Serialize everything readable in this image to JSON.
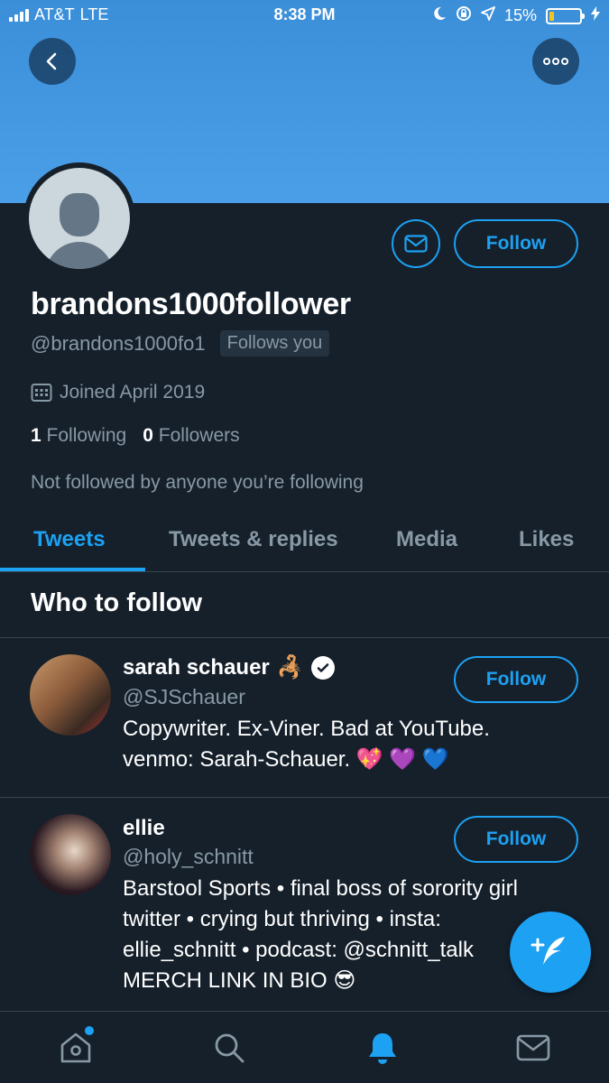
{
  "status_bar": {
    "carrier": "AT&T",
    "network": "LTE",
    "time": "8:38 PM",
    "battery": "15%"
  },
  "profile": {
    "display_name": "brandons1000follower",
    "handle": "@brandons1000fo1",
    "follows_you": "Follows you",
    "joined": "Joined April 2019",
    "following_count": "1",
    "following_label": "Following",
    "followers_count": "0",
    "followers_label": "Followers",
    "mutuals": "Not followed by anyone you’re following",
    "follow_label": "Follow"
  },
  "tabs": [
    {
      "label": "Tweets",
      "active": true
    },
    {
      "label": "Tweets & replies",
      "active": false
    },
    {
      "label": "Media",
      "active": false
    },
    {
      "label": "Likes",
      "active": false
    }
  ],
  "who_to_follow": {
    "title": "Who to follow",
    "users": [
      {
        "name": "sarah schauer",
        "name_emoji": "🦂",
        "handle": "@SJSchauer",
        "bio_line1": "Copywriter. Ex-Viner. Bad at YouTube.",
        "bio_line2": "venmo: Sarah-Schauer. 💖 💜 💙",
        "follow_label": "Follow",
        "verified": true
      },
      {
        "name": "ellie",
        "handle": "@holy_schnitt",
        "bio_line1": "Barstool Sports • final boss of sorority girl",
        "bio_line2": "twitter • crying but thriving • insta:",
        "bio_line3": "ellie_schnitt • podcast: @schnitt_talk",
        "bio_line4": "MERCH LINK IN BIO 😎",
        "follow_label": "Follow",
        "verified": false
      }
    ]
  },
  "colors": {
    "background": "#15202b",
    "accent": "#1da1f2",
    "secondary_text": "#8899a6",
    "banner": "#4a9fe8"
  },
  "icons": {
    "back": "back-arrow-icon",
    "more": "more-icon",
    "message": "envelope-icon",
    "calendar": "calendar-icon",
    "compose": "compose-tweet-icon",
    "nav": [
      "home-icon",
      "search-icon",
      "notifications-bell-icon",
      "messages-icon"
    ]
  }
}
